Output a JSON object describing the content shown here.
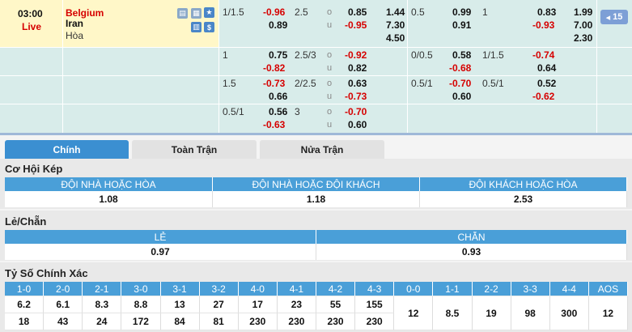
{
  "match": {
    "time": "03:00",
    "status": "Live",
    "home": "Belgium",
    "away": "Iran",
    "draw": "Hòa",
    "badge": "15"
  },
  "odds_rows": [
    {
      "h1": "1/1.5",
      "h1_home": "-0.96",
      "h1_away": "0.89",
      "ou1": "2.5",
      "ou1_o": "0.85",
      "ou1_u": "-0.95",
      "x1_1": "1.44",
      "x1_2": "7.30",
      "x1_3": "4.50",
      "h2": "0.5",
      "h2_home": "0.99",
      "h2_away": "0.91",
      "ou2": "1",
      "ou2_o": "0.83",
      "ou2_u": "-0.93",
      "x2_1": "1.99",
      "x2_2": "7.00",
      "x2_3": "2.30"
    },
    {
      "h1": "1",
      "h1_home": "0.75",
      "h1_away": "-0.82",
      "ou1": "2.5/3",
      "ou1_o": "-0.92",
      "ou1_u": "0.82",
      "h2": "0/0.5",
      "h2_home": "0.58",
      "h2_away": "-0.68",
      "ou2": "1/1.5",
      "ou2_o": "-0.74",
      "ou2_u": "0.64"
    },
    {
      "h1": "1.5",
      "h1_home": "-0.73",
      "h1_away": "0.66",
      "ou1": "2/2.5",
      "ou1_o": "0.63",
      "ou1_u": "-0.73",
      "h2": "0.5/1",
      "h2_home": "-0.70",
      "h2_away": "0.60",
      "ou2": "0.5/1",
      "ou2_o": "0.52",
      "ou2_u": "-0.62"
    },
    {
      "h1": "0.5/1",
      "h1_home": "0.56",
      "h1_away": "-0.63",
      "ou1": "3",
      "ou1_o": "-0.70",
      "ou1_u": "0.60"
    }
  ],
  "ou_labels": {
    "o": "o",
    "u": "u"
  },
  "tabs": [
    "Chính",
    "Toàn Trận",
    "Nửa Trận"
  ],
  "double_chance": {
    "title": "Cơ Hội Kép",
    "headers": [
      "ĐỘI NHÀ HOẶC HÒA",
      "ĐỘI NHÀ HOẶC ĐỘI KHÁCH",
      "ĐỘI KHÁCH HOẶC HÒA"
    ],
    "values": [
      "1.08",
      "1.18",
      "2.53"
    ]
  },
  "odd_even": {
    "title": "Lẻ/Chẵn",
    "headers": [
      "LẺ",
      "CHẴN"
    ],
    "values": [
      "0.97",
      "0.93"
    ]
  },
  "correct_score": {
    "title": "Tỷ Số Chính Xác",
    "headers": [
      "1-0",
      "2-0",
      "2-1",
      "3-0",
      "3-1",
      "3-2",
      "4-0",
      "4-1",
      "4-2",
      "4-3",
      "0-0",
      "1-1",
      "2-2",
      "3-3",
      "4-4",
      "AOS"
    ],
    "row1": [
      "6.2",
      "6.1",
      "8.3",
      "8.8",
      "13",
      "27",
      "17",
      "23",
      "55",
      "155"
    ],
    "row2": [
      "18",
      "43",
      "24",
      "172",
      "84",
      "81",
      "230",
      "230",
      "230",
      "230"
    ],
    "draws": [
      "12",
      "8.5",
      "19",
      "98",
      "300",
      "12"
    ]
  }
}
